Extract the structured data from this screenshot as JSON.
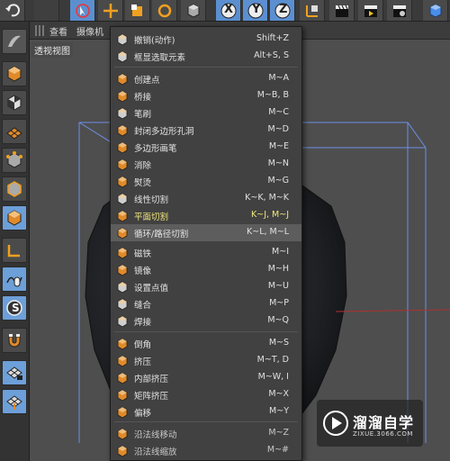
{
  "viewport": {
    "menus": [
      "查看",
      "摄像机"
    ],
    "view_label": "透视视图"
  },
  "toolbar": {
    "axis_x": "X",
    "axis_y": "Y",
    "axis_z": "Z"
  },
  "lefttools": {
    "s_label": "S"
  },
  "menu": {
    "items": [
      {
        "label": "撤销(动作)",
        "shortcut": "Shift+Z",
        "icon": "undo-icon"
      },
      {
        "label": "框显选取元素",
        "shortcut": "Alt+S, S",
        "icon": "frame-selection-icon"
      },
      {
        "label": "创建点",
        "shortcut": "M~A",
        "icon": "create-point-icon"
      },
      {
        "label": "桥接",
        "shortcut": "M~B, B",
        "icon": "bridge-icon"
      },
      {
        "label": "笔刷",
        "shortcut": "M~C",
        "icon": "brush-icon"
      },
      {
        "label": "封闭多边形孔洞",
        "shortcut": "M~D",
        "icon": "close-hole-icon"
      },
      {
        "label": "多边形画笔",
        "shortcut": "M~E",
        "icon": "polygon-pen-icon"
      },
      {
        "label": "消除",
        "shortcut": "M~N",
        "icon": "dissolve-icon"
      },
      {
        "label": "熨烫",
        "shortcut": "M~G",
        "icon": "iron-icon"
      },
      {
        "label": "线性切割",
        "shortcut": "K~K, M~K",
        "icon": "line-cut-icon"
      },
      {
        "label": "平面切割",
        "shortcut": "K~J, M~J",
        "icon": "plane-cut-icon"
      },
      {
        "label": "循环/路径切割",
        "shortcut": "K~L, M~L",
        "icon": "loop-cut-icon"
      },
      {
        "label": "磁铁",
        "shortcut": "M~I",
        "icon": "magnet-icon"
      },
      {
        "label": "镜像",
        "shortcut": "M~H",
        "icon": "mirror-icon"
      },
      {
        "label": "设置点值",
        "shortcut": "M~U",
        "icon": "set-point-value-icon"
      },
      {
        "label": "缝合",
        "shortcut": "M~P",
        "icon": "stitch-icon"
      },
      {
        "label": "焊接",
        "shortcut": "M~Q",
        "icon": "weld-icon"
      },
      {
        "label": "倒角",
        "shortcut": "M~S",
        "icon": "bevel-icon"
      },
      {
        "label": "挤压",
        "shortcut": "M~T, D",
        "icon": "extrude-icon"
      },
      {
        "label": "内部挤压",
        "shortcut": "M~W, I",
        "icon": "extrude-inner-icon"
      },
      {
        "label": "矩阵挤压",
        "shortcut": "M~X",
        "icon": "matrix-extrude-icon"
      },
      {
        "label": "偏移",
        "shortcut": "M~Y",
        "icon": "offset-icon"
      },
      {
        "label": "沿法线移动",
        "shortcut": "M~Z",
        "icon": "normal-move-icon"
      },
      {
        "label": "沿法线缩放",
        "shortcut": "M~#",
        "icon": "normal-scale-icon"
      }
    ]
  },
  "watermark": {
    "name": "溜溜自学",
    "url": "ZIXUE.3066.COM"
  },
  "colors": {
    "menu_bg": "#414141",
    "highlight": "#5d5d5d",
    "accent_blue": "#6d9fd8",
    "active_text": "#f0e67a",
    "wireframe": "#6f8fe8"
  }
}
